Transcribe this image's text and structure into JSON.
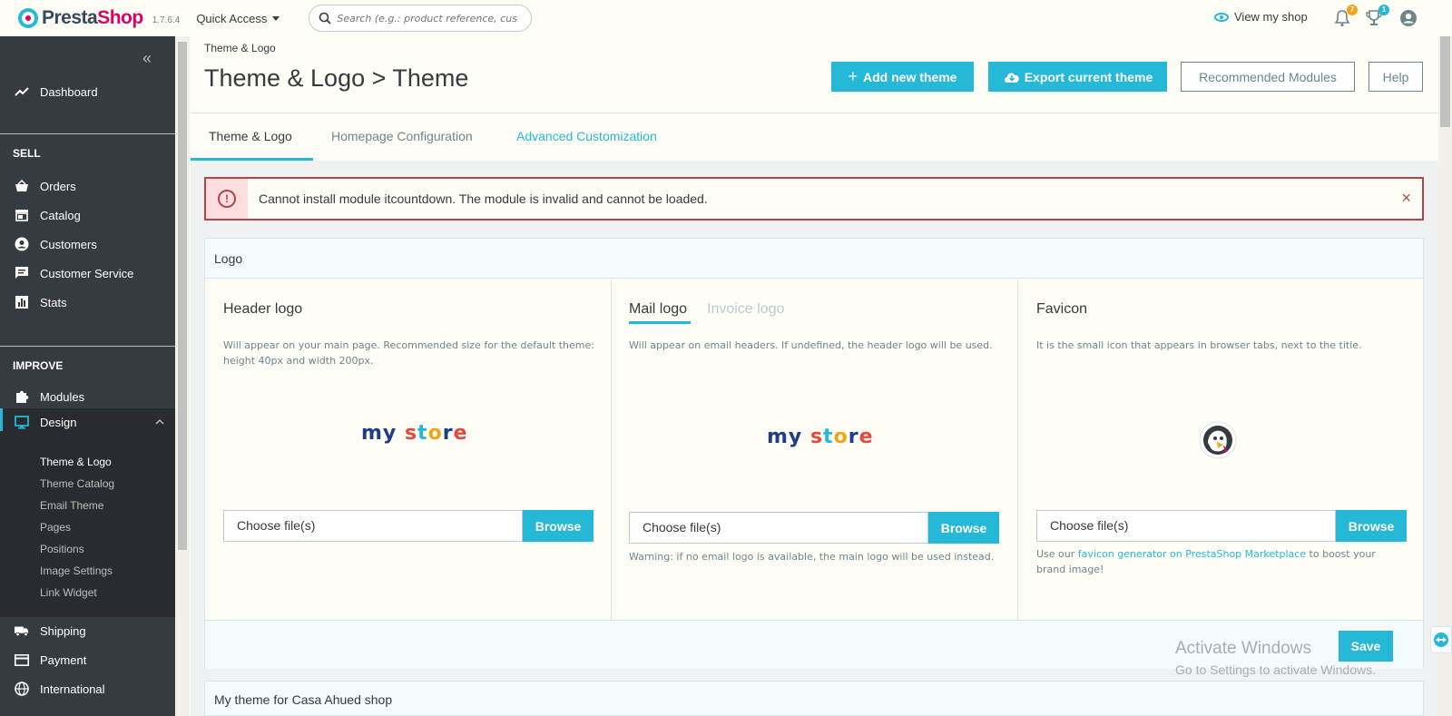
{
  "header": {
    "brand_main": "Presta",
    "brand_accent": "Shop",
    "version": "1.7.6.4",
    "quick_access": "Quick Access",
    "search_placeholder": "Search (e.g.: product reference, custome",
    "view_shop": "View my shop",
    "notifications_count": "7",
    "orders_count": "1"
  },
  "sidebar": {
    "dashboard": "Dashboard",
    "sell_title": "SELL",
    "orders": "Orders",
    "catalog": "Catalog",
    "customers": "Customers",
    "customer_service": "Customer Service",
    "stats": "Stats",
    "improve_title": "IMPROVE",
    "modules": "Modules",
    "design": "Design",
    "design_sub": [
      "Theme & Logo",
      "Theme Catalog",
      "Email Theme",
      "Pages",
      "Positions",
      "Image Settings",
      "Link Widget"
    ],
    "shipping": "Shipping",
    "payment": "Payment",
    "international": "International",
    "collapse_icon": "«"
  },
  "page": {
    "breadcrumb": "Theme & Logo",
    "title": "Theme & Logo > Theme",
    "add_theme": "Add new theme",
    "export_theme": "Export current theme",
    "recommended": "Recommended Modules",
    "help": "Help"
  },
  "tabs": {
    "theme_logo": "Theme & Logo",
    "homepage": "Homepage Configuration",
    "advanced": "Advanced Customization"
  },
  "alert": {
    "icon": "!",
    "message": "Cannot install module itcountdown. The module is invalid and cannot be loaded.",
    "close": "×"
  },
  "logo_card": {
    "title": "Logo",
    "header_logo": {
      "title": "Header logo",
      "desc_line1": "Will appear on your main page. Recommended size for the default theme:",
      "desc_line2": "height 40px and width 200px.",
      "file_placeholder": "Choose file(s)",
      "browse": "Browse"
    },
    "mail_logo": {
      "tab_mail": "Mail logo",
      "tab_invoice": "Invoice logo",
      "desc": "Will appear on email headers. If undefined, the header logo will be used.",
      "file_placeholder": "Choose file(s)",
      "browse": "Browse",
      "warning": "Warning: if no email logo is available, the main logo will be used instead."
    },
    "favicon": {
      "title": "Favicon",
      "desc": "It is the small icon that appears in browser tabs, next to the title.",
      "file_placeholder": "Choose file(s)",
      "browse": "Browse",
      "note_prefix": "Use our ",
      "note_link": "favicon generator on PrestaShop Marketplace",
      "note_suffix": " to boost your",
      "note_line2": "brand image!"
    },
    "store_logo": {
      "my": "my",
      "s": "s",
      "t": "t",
      "o": "o",
      "r": "r",
      "e": "e"
    },
    "save": "Save"
  },
  "theme_card": {
    "title": "My theme for Casa Ahued shop"
  },
  "watermark": {
    "line1": "Activate Windows",
    "line2": "Go to Settings to activate Windows."
  },
  "colors": {
    "accent": "#25b9d7",
    "sidebar": "#363a41",
    "danger": "#b2454c",
    "brand_pink": "#df0067"
  }
}
